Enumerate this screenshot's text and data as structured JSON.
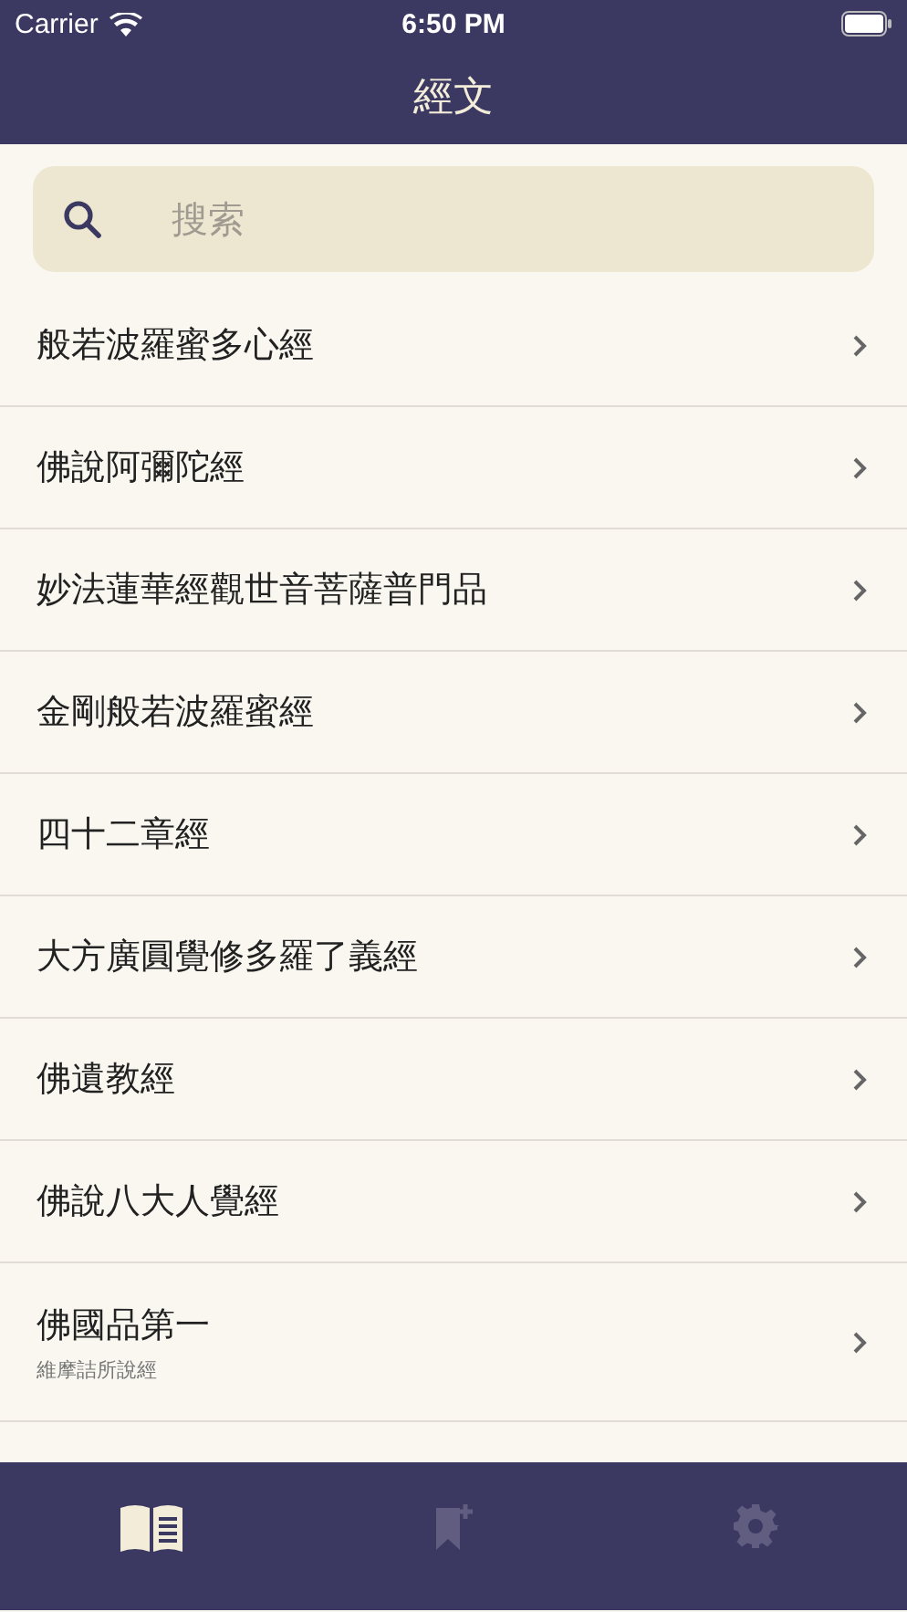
{
  "status_bar": {
    "carrier": "Carrier",
    "time": "6:50 PM"
  },
  "nav": {
    "title": "經文"
  },
  "search": {
    "placeholder": "搜索"
  },
  "rows": [
    {
      "title": "般若波羅蜜多心經"
    },
    {
      "title": "佛說阿彌陀經"
    },
    {
      "title": "妙法蓮華經觀世音菩薩普門品"
    },
    {
      "title": "金剛般若波羅蜜經"
    },
    {
      "title": "四十二章經"
    },
    {
      "title": "大方廣圓覺修多羅了義經"
    },
    {
      "title": "佛遺教經"
    },
    {
      "title": "佛說八大人覺經"
    },
    {
      "title": "佛國品第一",
      "subtitle": "維摩詰所說經"
    }
  ],
  "tabs": [
    {
      "kind": "book",
      "selected": true
    },
    {
      "kind": "bookmark",
      "selected": false
    },
    {
      "kind": "settings",
      "selected": false
    }
  ]
}
